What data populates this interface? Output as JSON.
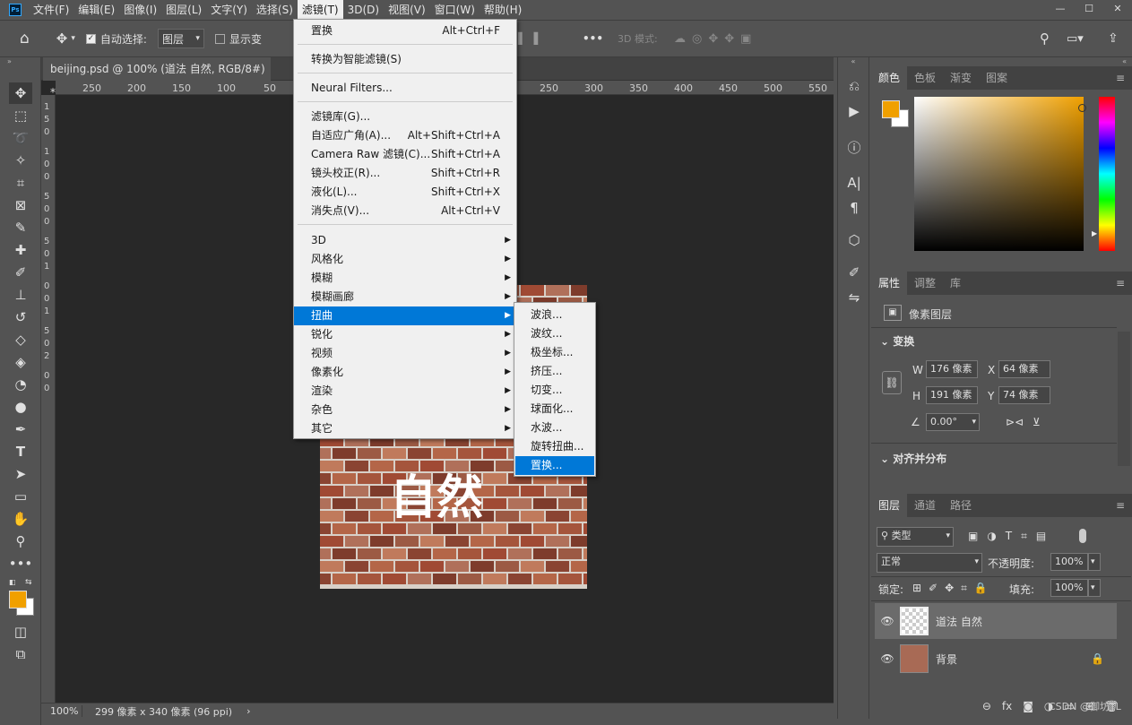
{
  "menubar": {
    "logo": "Ps",
    "items": [
      "文件(F)",
      "编辑(E)",
      "图像(I)",
      "图层(L)",
      "文字(Y)",
      "选择(S)",
      "滤镜(T)",
      "3D(D)",
      "视图(V)",
      "窗口(W)",
      "帮助(H)"
    ],
    "active_index": 6
  },
  "options": {
    "auto_select_label": "自动选择:",
    "auto_select_value": "图层",
    "show_transform_label": "显示变",
    "mode_3d_label": "3D 模式:",
    "more": "•••"
  },
  "document": {
    "tab_title": "beijing.psd @ 100% (道法 自然, RGB/8#) *",
    "close": "×",
    "ruler_h_left": [
      "250",
      "200",
      "150",
      "100",
      "50"
    ],
    "ruler_h_right": [
      "250",
      "300",
      "350",
      "400",
      "450",
      "500",
      "550"
    ],
    "ruler_v": [
      "1",
      "5",
      "0",
      "1",
      "0",
      "0",
      "5",
      "0",
      "0",
      "5",
      "0",
      "1",
      "0",
      "0",
      "1",
      "5",
      "0",
      "2",
      "0",
      "0"
    ],
    "zoom": "100%",
    "status": "299 像素 x 340 像素 (96 ppi)",
    "image_text": "自然"
  },
  "filter_menu": {
    "items": [
      {
        "label": "置换",
        "shortcut": "Alt+Ctrl+F"
      },
      {
        "label": "转换为智能滤镜(S)",
        "shortcut": ""
      },
      {
        "label": "Neural Filters...",
        "shortcut": ""
      },
      {
        "label": "滤镜库(G)...",
        "shortcut": ""
      },
      {
        "label": "自适应广角(A)...",
        "shortcut": "Alt+Shift+Ctrl+A"
      },
      {
        "label": "Camera Raw 滤镜(C)...",
        "shortcut": "Shift+Ctrl+A"
      },
      {
        "label": "镜头校正(R)...",
        "shortcut": "Shift+Ctrl+R"
      },
      {
        "label": "液化(L)...",
        "shortcut": "Shift+Ctrl+X"
      },
      {
        "label": "消失点(V)...",
        "shortcut": "Alt+Ctrl+V"
      },
      {
        "label": "3D",
        "shortcut": ""
      },
      {
        "label": "风格化",
        "shortcut": ""
      },
      {
        "label": "模糊",
        "shortcut": ""
      },
      {
        "label": "模糊画廊",
        "shortcut": ""
      },
      {
        "label": "扭曲",
        "shortcut": ""
      },
      {
        "label": "锐化",
        "shortcut": ""
      },
      {
        "label": "视频",
        "shortcut": ""
      },
      {
        "label": "像素化",
        "shortcut": ""
      },
      {
        "label": "渲染",
        "shortcut": ""
      },
      {
        "label": "杂色",
        "shortcut": ""
      },
      {
        "label": "其它",
        "shortcut": ""
      }
    ],
    "highlighted": "扭曲"
  },
  "distort_submenu": {
    "items": [
      "波浪...",
      "波纹...",
      "极坐标...",
      "挤压...",
      "切变...",
      "球面化...",
      "水波...",
      "旋转扭曲...",
      "置换..."
    ],
    "highlighted": "置换..."
  },
  "color_panel": {
    "tabs": [
      "颜色",
      "色板",
      "渐变",
      "图案"
    ],
    "foreground": "#f0a000",
    "background": "#ffffff"
  },
  "properties_panel": {
    "tabs": [
      "属性",
      "调整",
      "库"
    ],
    "layer_type": "像素图层",
    "transform_title": "变换",
    "w": "176 像素",
    "h": "191 像素",
    "x": "64 像素",
    "y": "74 像素",
    "angle": "0.00°",
    "align_title": "对齐并分布",
    "labels": {
      "w": "W",
      "h": "H",
      "x": "X",
      "y": "Y"
    }
  },
  "layers_panel": {
    "tabs": [
      "图层",
      "通道",
      "路径"
    ],
    "filter": "类型",
    "blend": "正常",
    "opacity_label": "不透明度:",
    "opacity": "100%",
    "lock_label": "锁定:",
    "fill_label": "填充:",
    "fill": "100%",
    "layers": [
      {
        "name": "道法 自然",
        "selected": true
      },
      {
        "name": "背景",
        "selected": false
      }
    ]
  },
  "watermark": "CSDN @御坊TL"
}
